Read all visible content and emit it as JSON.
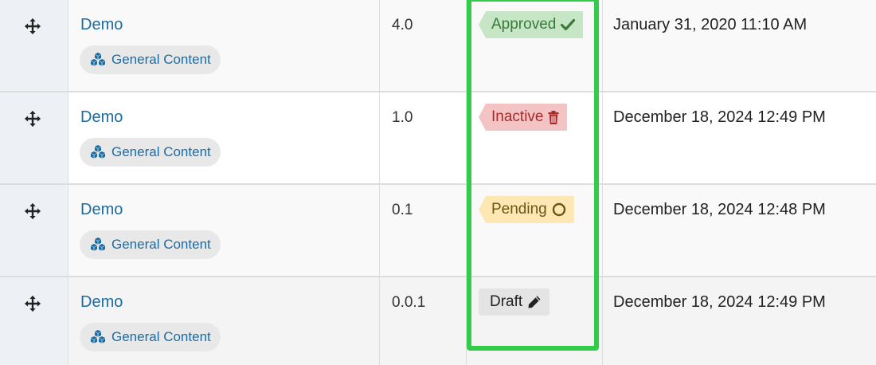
{
  "rows": [
    {
      "title": "Demo",
      "type": "General Content",
      "version": "4.0",
      "status": "Approved",
      "status_icon": "check-icon",
      "date": "January 31, 2020 11:10 AM"
    },
    {
      "title": "Demo",
      "type": "General Content",
      "version": "1.0",
      "status": "Inactive",
      "status_icon": "trash-icon",
      "date": "December 18, 2024 12:49 PM"
    },
    {
      "title": "Demo",
      "type": "General Content",
      "version": "0.1",
      "status": "Pending",
      "status_icon": "circle-icon",
      "date": "December 18, 2024 12:48 PM"
    },
    {
      "title": "Demo",
      "type": "General Content",
      "version": "0.0.1",
      "status": "Draft",
      "status_icon": "pencil-icon",
      "date": "December 18, 2024 12:49 PM"
    }
  ],
  "colors": {
    "link": "#1c6ca1",
    "approved_bg": "#c6e6c6",
    "inactive_bg": "#f4c4c4",
    "pending_bg": "#fde7b3",
    "draft_bg": "#e4e4e4",
    "highlight": "#33cc4a"
  }
}
